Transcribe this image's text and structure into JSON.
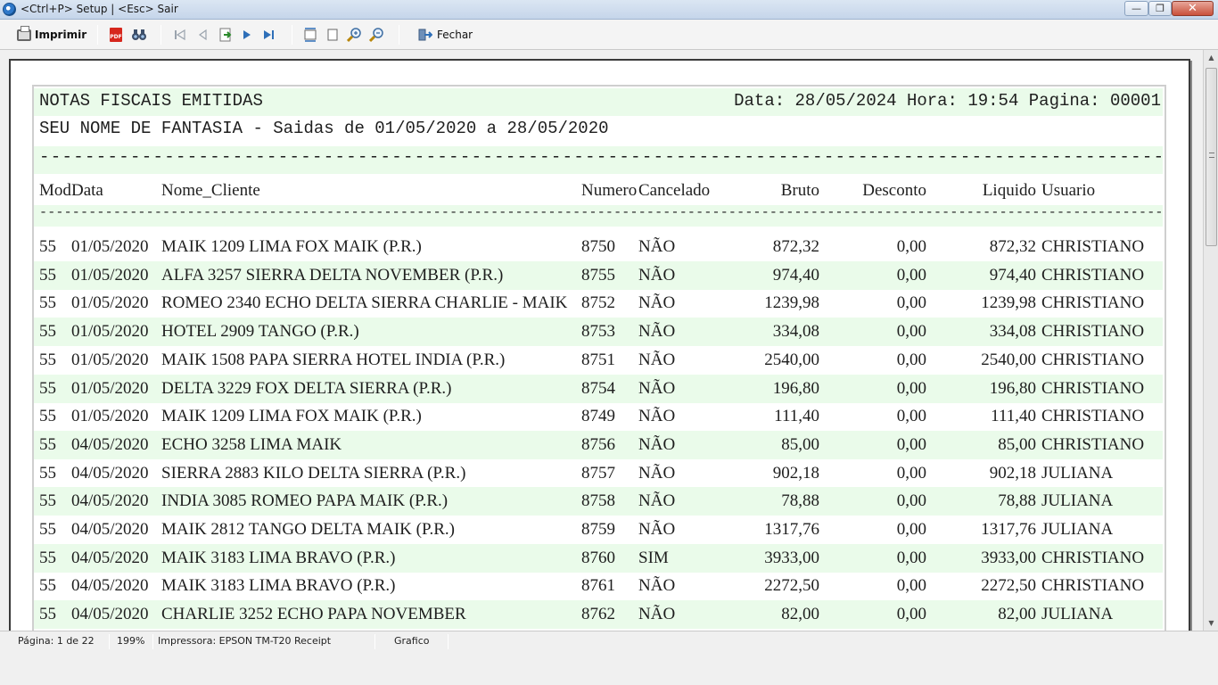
{
  "window": {
    "title": "<Ctrl+P> Setup | <Esc> Sair",
    "min_glyph": "—",
    "max_glyph": "❐",
    "close_glyph": "✕"
  },
  "toolbar": {
    "print_label": "Imprimir",
    "pdf_label": "PDF",
    "close_label": "Fechar"
  },
  "report": {
    "title": "NOTAS FISCAIS EMITIDAS",
    "date_info": "Data: 28/05/2024 Hora: 19:54 Pagina: 00001",
    "subtitle": "SEU NOME DE FANTASIA - Saidas de 01/05/2020 a 28/05/2020",
    "columns": {
      "mod": "Mod",
      "data": "Data",
      "cliente": "Nome_Cliente",
      "numero": "Numero",
      "cancelado": "Cancelado",
      "bruto": "Bruto",
      "desconto": "Desconto",
      "liquido": "Liquido",
      "usuario": "Usuario"
    },
    "rows": [
      {
        "mod": "55",
        "data": "01/05/2020",
        "cliente": "MAIK 1209 LIMA FOX MAIK (P.R.)",
        "numero": "8750",
        "cancelado": "NÃO",
        "bruto": "872,32",
        "desconto": "0,00",
        "liquido": "872,32",
        "usuario": "CHRISTIANO"
      },
      {
        "mod": "55",
        "data": "01/05/2020",
        "cliente": "ALFA 3257 SIERRA DELTA NOVEMBER (P.R.)",
        "numero": "8755",
        "cancelado": "NÃO",
        "bruto": "974,40",
        "desconto": "0,00",
        "liquido": "974,40",
        "usuario": "CHRISTIANO"
      },
      {
        "mod": "55",
        "data": "01/05/2020",
        "cliente": "ROMEO 2340 ECHO DELTA SIERRA CHARLIE - MAIK",
        "numero": "8752",
        "cancelado": "NÃO",
        "bruto": "1239,98",
        "desconto": "0,00",
        "liquido": "1239,98",
        "usuario": "CHRISTIANO"
      },
      {
        "mod": "55",
        "data": "01/05/2020",
        "cliente": "HOTEL 2909 TANGO (P.R.)",
        "numero": "8753",
        "cancelado": "NÃO",
        "bruto": "334,08",
        "desconto": "0,00",
        "liquido": "334,08",
        "usuario": "CHRISTIANO"
      },
      {
        "mod": "55",
        "data": "01/05/2020",
        "cliente": "MAIK 1508 PAPA SIERRA HOTEL INDIA (P.R.)",
        "numero": "8751",
        "cancelado": "NÃO",
        "bruto": "2540,00",
        "desconto": "0,00",
        "liquido": "2540,00",
        "usuario": "CHRISTIANO"
      },
      {
        "mod": "55",
        "data": "01/05/2020",
        "cliente": "DELTA 3229 FOX DELTA SIERRA (P.R.)",
        "numero": "8754",
        "cancelado": "NÃO",
        "bruto": "196,80",
        "desconto": "0,00",
        "liquido": "196,80",
        "usuario": "CHRISTIANO"
      },
      {
        "mod": "55",
        "data": "01/05/2020",
        "cliente": "MAIK 1209 LIMA FOX MAIK (P.R.)",
        "numero": "8749",
        "cancelado": "NÃO",
        "bruto": "111,40",
        "desconto": "0,00",
        "liquido": "111,40",
        "usuario": "CHRISTIANO"
      },
      {
        "mod": "55",
        "data": "04/05/2020",
        "cliente": "ECHO 3258 LIMA MAIK",
        "numero": "8756",
        "cancelado": "NÃO",
        "bruto": "85,00",
        "desconto": "0,00",
        "liquido": "85,00",
        "usuario": "CHRISTIANO"
      },
      {
        "mod": "55",
        "data": "04/05/2020",
        "cliente": "SIERRA 2883 KILO DELTA SIERRA (P.R.)",
        "numero": "8757",
        "cancelado": "NÃO",
        "bruto": "902,18",
        "desconto": "0,00",
        "liquido": "902,18",
        "usuario": "JULIANA"
      },
      {
        "mod": "55",
        "data": "04/05/2020",
        "cliente": "INDIA 3085 ROMEO PAPA MAIK (P.R.)",
        "numero": "8758",
        "cancelado": "NÃO",
        "bruto": "78,88",
        "desconto": "0,00",
        "liquido": "78,88",
        "usuario": "JULIANA"
      },
      {
        "mod": "55",
        "data": "04/05/2020",
        "cliente": "MAIK 2812 TANGO DELTA MAIK (P.R.)",
        "numero": "8759",
        "cancelado": "NÃO",
        "bruto": "1317,76",
        "desconto": "0,00",
        "liquido": "1317,76",
        "usuario": "JULIANA"
      },
      {
        "mod": "55",
        "data": "04/05/2020",
        "cliente": "MAIK 3183 LIMA BRAVO (P.R.)",
        "numero": "8760",
        "cancelado": "SIM",
        "bruto": "3933,00",
        "desconto": "0,00",
        "liquido": "3933,00",
        "usuario": "CHRISTIANO"
      },
      {
        "mod": "55",
        "data": "04/05/2020",
        "cliente": "MAIK 3183 LIMA BRAVO (P.R.)",
        "numero": "8761",
        "cancelado": "NÃO",
        "bruto": "2272,50",
        "desconto": "0,00",
        "liquido": "2272,50",
        "usuario": "CHRISTIANO"
      },
      {
        "mod": "55",
        "data": "04/05/2020",
        "cliente": "CHARLIE 3252 ECHO PAPA NOVEMBER",
        "numero": "8762",
        "cancelado": "NÃO",
        "bruto": "82,00",
        "desconto": "0,00",
        "liquido": "82,00",
        "usuario": "JULIANA"
      }
    ]
  },
  "status": {
    "page": "Página: 1 de 22",
    "zoom": "199%",
    "printer": "Impressora: EPSON TM-T20 Receipt",
    "mode": "Grafico"
  },
  "colors": {
    "row_alt": "#eafbea",
    "close_button": "#c9503b"
  }
}
